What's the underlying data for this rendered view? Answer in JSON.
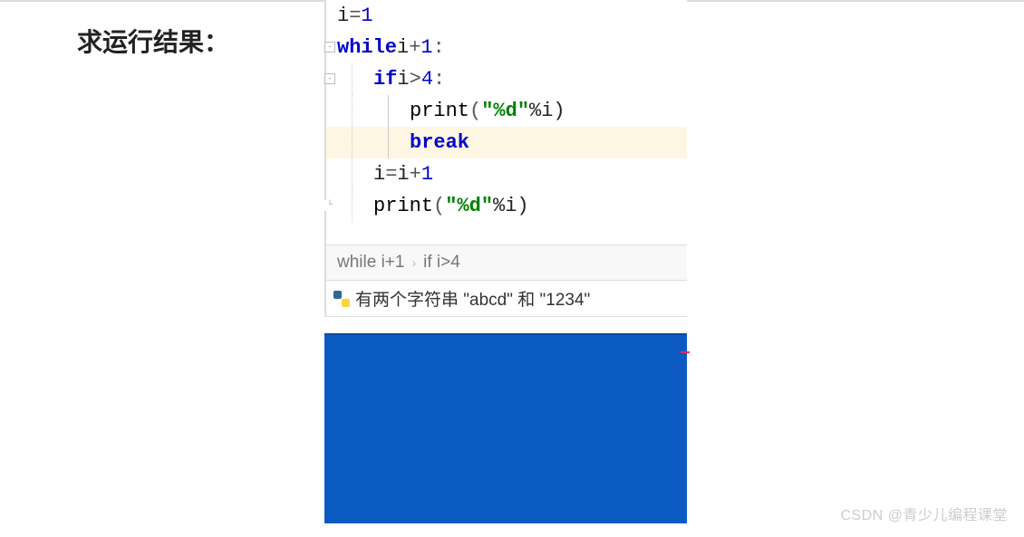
{
  "question_label": "求运行结果：",
  "code": {
    "line1": {
      "var": "i",
      "eq": "=",
      "val": "1"
    },
    "line2": {
      "kw": "while",
      "expr_pre": " i",
      "expr_op": "+",
      "expr_post": "1",
      "colon": ":"
    },
    "line3": {
      "kw": "if",
      "expr_pre": " i",
      "expr_op": ">",
      "expr_post": "4",
      "colon": ":"
    },
    "line4": {
      "fn": "print",
      "paren_open": "(",
      "str": "\"%d\"",
      "after": "%i)",
      "paren": ""
    },
    "line5": {
      "kw": "break"
    },
    "line6": {
      "lhs": "i",
      "eq": "=",
      "rhs": "i",
      "op": "+",
      "val": "1"
    },
    "line7": {
      "fn": "print",
      "paren_open": "(",
      "str": "\"%d\"",
      "after": "%i)"
    }
  },
  "breadcrumb": {
    "item1": "while i+1",
    "sep": "›",
    "item2": "if i>4"
  },
  "tab": {
    "label": "有两个字符串 \"abcd\" 和 \"1234\""
  },
  "watermark": "CSDN @青少儿编程课堂"
}
